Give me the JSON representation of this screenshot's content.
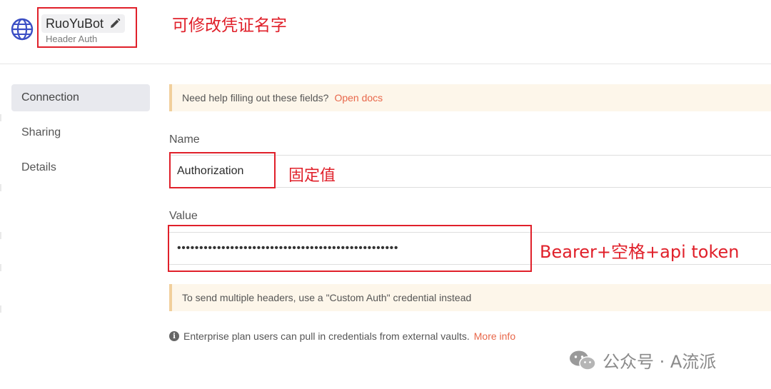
{
  "header": {
    "credential_name": "RuoYuBot",
    "credential_type": "Header Auth",
    "icons": {
      "app": "globe-icon",
      "edit": "pencil-icon"
    }
  },
  "annotations": {
    "title_note": "可修改凭证名字",
    "name_note": "固定值",
    "value_note": "Bearer+空格+api token",
    "color": "#e0202a"
  },
  "sidebar": {
    "items": [
      {
        "label": "Connection",
        "active": true
      },
      {
        "label": "Sharing",
        "active": false
      },
      {
        "label": "Details",
        "active": false
      }
    ]
  },
  "main": {
    "help_text": "Need help filling out these fields?",
    "help_link": "Open docs",
    "name_label": "Name",
    "name_value": "Authorization",
    "value_label": "Value",
    "value_masked": "••••••••••••••••••••••••••••••••••••••••••••••••••",
    "multi_header_note": "To send multiple headers, use a \"Custom Auth\" credential instead",
    "enterprise_text": "Enterprise plan users can pull in credentials from external vaults.",
    "enterprise_link": "More info",
    "link_color": "#e8674a"
  },
  "watermark": {
    "text": "公众号 · A流派",
    "icon": "wechat-icon"
  }
}
